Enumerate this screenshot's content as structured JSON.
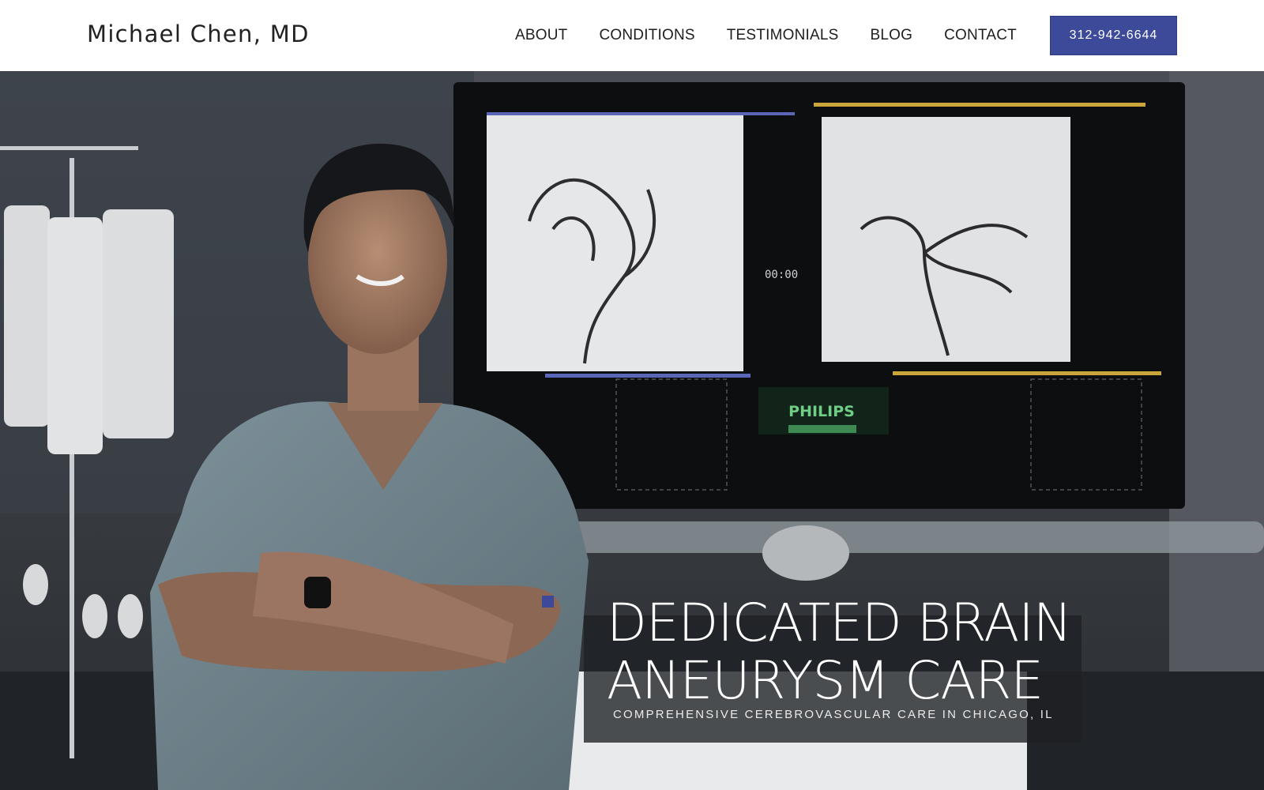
{
  "header": {
    "brand": "Michael Chen, MD",
    "nav": [
      {
        "label": "ABOUT"
      },
      {
        "label": "CONDITIONS"
      },
      {
        "label": "TESTIMONIALS"
      },
      {
        "label": "BLOG"
      },
      {
        "label": "CONTACT"
      }
    ],
    "phone": "312-942-6644"
  },
  "hero": {
    "title_line1": "DEDICATED BRAIN",
    "title_line2": "ANEURYSM CARE",
    "subtitle": "COMPREHENSIVE CEREBROVASCULAR CARE IN CHICAGO, IL",
    "monitor_brand": "PHILIPS",
    "monitor_timer": "00:00"
  },
  "colors": {
    "accent": "#3d4a99",
    "header_bg": "#ffffff",
    "nav_text": "#1e1e1e",
    "hero_text": "#ffffff"
  },
  "icons": {
    "accent_marker": "square-icon"
  }
}
